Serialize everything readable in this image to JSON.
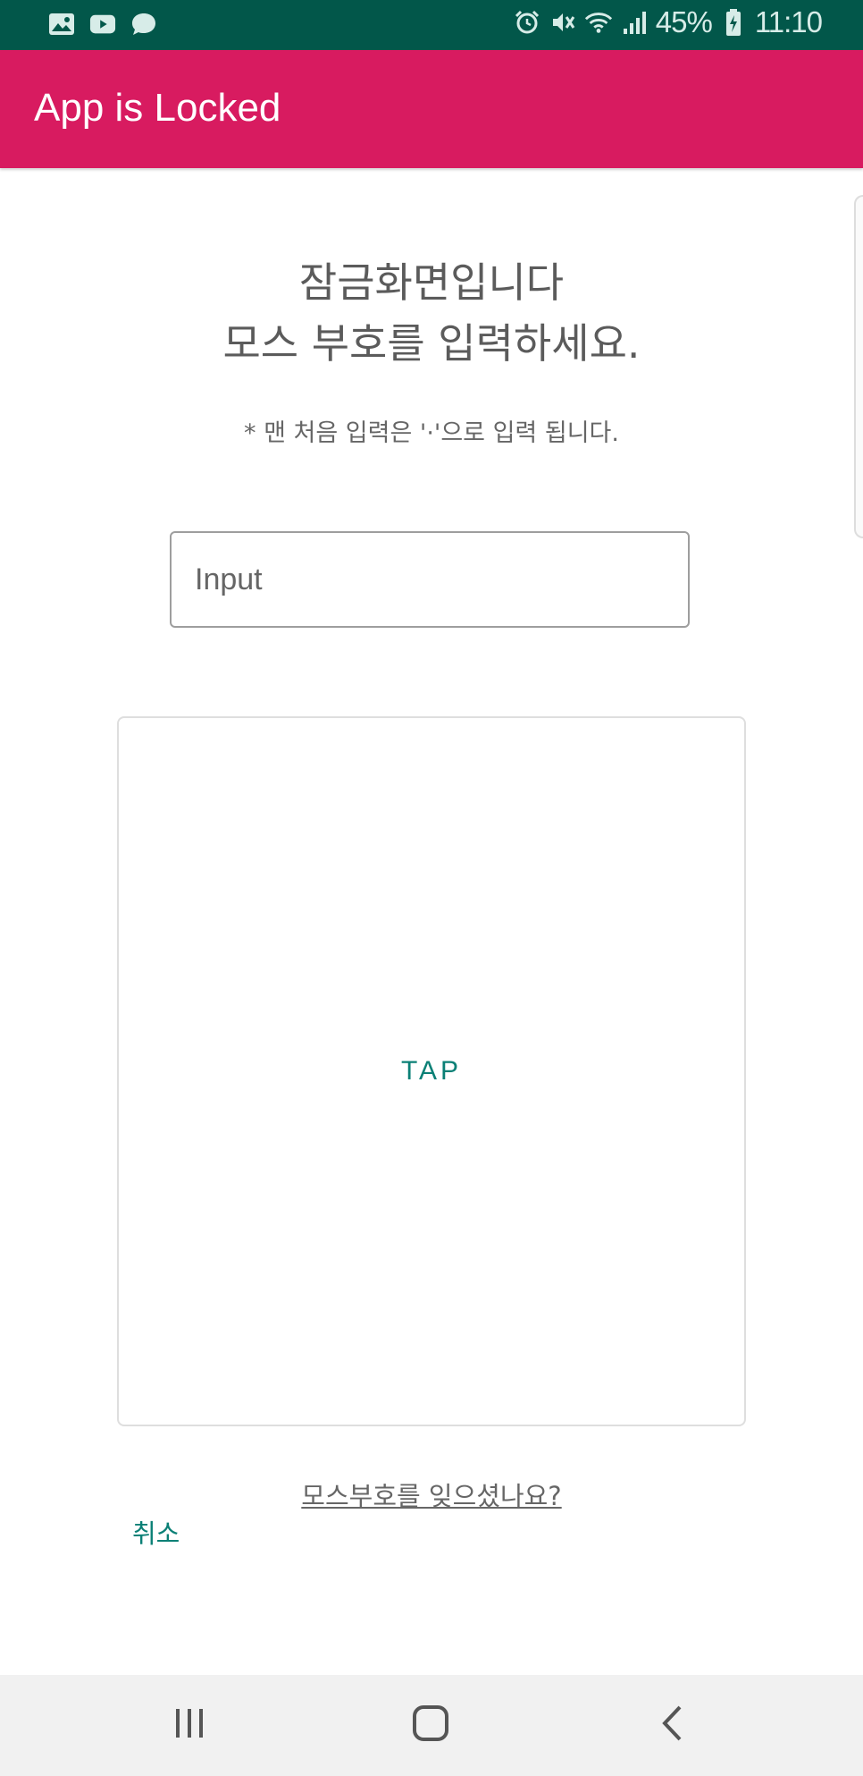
{
  "status_bar": {
    "battery": "45%",
    "time": "11:10",
    "left_icons": [
      "gallery-icon",
      "youtube-icon",
      "chat-icon"
    ],
    "right_icons": [
      "alarm-icon",
      "mute-icon",
      "wifi-icon",
      "signal-icon",
      "battery-charging-icon"
    ],
    "background": "#02574a"
  },
  "app_bar": {
    "title": "App is Locked",
    "background": "#d81b60"
  },
  "main": {
    "heading_line1": "잠금화면입니다",
    "heading_line2": "모스 부호를 입력하세요.",
    "hint": "* 맨 처음 입력은 '·'으로 입력 됩니다.",
    "input_placeholder": "Input",
    "input_value": "",
    "tap_label": "TAP",
    "forgot_link": "모스부호를 잊으셨나요?",
    "cancel_label": "취소",
    "accent_color": "#0b8076"
  },
  "nav_bar": {
    "buttons": [
      "recents-icon",
      "home-icon",
      "back-icon"
    ]
  }
}
